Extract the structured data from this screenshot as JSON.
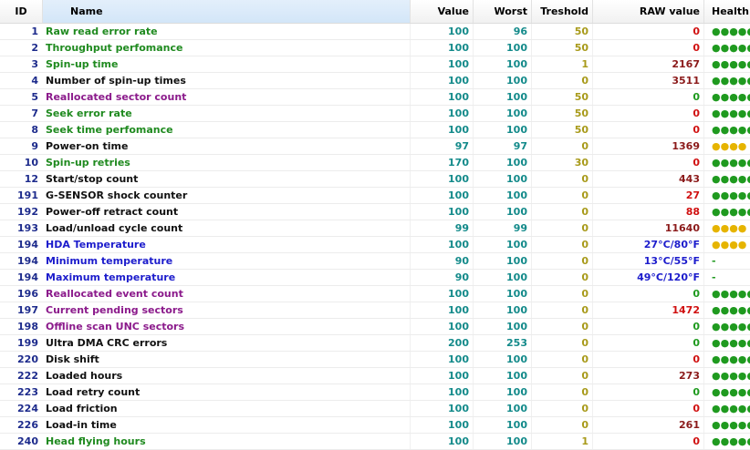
{
  "colors": {
    "name_default": "#111111",
    "name_green": "#1f8a1f",
    "name_purple": "#8b1a8b",
    "name_blue": "#1c1ccc",
    "raw_default": "#8b1a1a",
    "raw_red": "#d01010",
    "raw_green": "#1f9a1f",
    "raw_blue": "#1c1ccc",
    "health_good": "#1f9a1f",
    "health_warn": "#e6b400"
  },
  "headers": {
    "id": "ID",
    "name": "Name",
    "value": "Value",
    "worst": "Worst",
    "threshold": "Treshold",
    "raw": "RAW value",
    "health": "Health"
  },
  "rows": [
    {
      "id": "1",
      "name": "Raw read error rate",
      "name_color": "green",
      "value": "100",
      "worst": "96",
      "threshold": "50",
      "raw": "0",
      "raw_color": "red",
      "health": "●●●●●",
      "health_color": "good"
    },
    {
      "id": "2",
      "name": "Throughput perfomance",
      "name_color": "green",
      "value": "100",
      "worst": "100",
      "threshold": "50",
      "raw": "0",
      "raw_color": "red",
      "health": "●●●●●",
      "health_color": "good"
    },
    {
      "id": "3",
      "name": "Spin-up time",
      "name_color": "green",
      "value": "100",
      "worst": "100",
      "threshold": "1",
      "raw": "2167",
      "raw_color": "default",
      "health": "●●●●●",
      "health_color": "good"
    },
    {
      "id": "4",
      "name": "Number of spin-up times",
      "name_color": "default",
      "value": "100",
      "worst": "100",
      "threshold": "0",
      "raw": "3511",
      "raw_color": "default",
      "health": "●●●●●",
      "health_color": "good"
    },
    {
      "id": "5",
      "name": "Reallocated sector count",
      "name_color": "purple",
      "value": "100",
      "worst": "100",
      "threshold": "50",
      "raw": "0",
      "raw_color": "green",
      "health": "●●●●●",
      "health_color": "good"
    },
    {
      "id": "7",
      "name": "Seek error rate",
      "name_color": "green",
      "value": "100",
      "worst": "100",
      "threshold": "50",
      "raw": "0",
      "raw_color": "red",
      "health": "●●●●●",
      "health_color": "good"
    },
    {
      "id": "8",
      "name": "Seek time perfomance",
      "name_color": "green",
      "value": "100",
      "worst": "100",
      "threshold": "50",
      "raw": "0",
      "raw_color": "red",
      "health": "●●●●●",
      "health_color": "good"
    },
    {
      "id": "9",
      "name": "Power-on time",
      "name_color": "default",
      "value": "97",
      "worst": "97",
      "threshold": "0",
      "raw": "1369",
      "raw_color": "default",
      "health": "●●●●",
      "health_color": "warn"
    },
    {
      "id": "10",
      "name": "Spin-up retries",
      "name_color": "green",
      "value": "170",
      "worst": "100",
      "threshold": "30",
      "raw": "0",
      "raw_color": "red",
      "health": "●●●●●",
      "health_color": "good"
    },
    {
      "id": "12",
      "name": "Start/stop count",
      "name_color": "default",
      "value": "100",
      "worst": "100",
      "threshold": "0",
      "raw": "443",
      "raw_color": "default",
      "health": "●●●●●",
      "health_color": "good"
    },
    {
      "id": "191",
      "name": "G-SENSOR shock counter",
      "name_color": "default",
      "value": "100",
      "worst": "100",
      "threshold": "0",
      "raw": "27",
      "raw_color": "red",
      "health": "●●●●●",
      "health_color": "good"
    },
    {
      "id": "192",
      "name": "Power-off retract count",
      "name_color": "default",
      "value": "100",
      "worst": "100",
      "threshold": "0",
      "raw": "88",
      "raw_color": "red",
      "health": "●●●●●",
      "health_color": "good"
    },
    {
      "id": "193",
      "name": "Load/unload cycle count",
      "name_color": "default",
      "value": "99",
      "worst": "99",
      "threshold": "0",
      "raw": "11640",
      "raw_color": "default",
      "health": "●●●●",
      "health_color": "warn"
    },
    {
      "id": "194",
      "name": "HDA Temperature",
      "name_color": "blue",
      "value": "100",
      "worst": "100",
      "threshold": "0",
      "raw": "27°C/80°F",
      "raw_color": "blue",
      "health": "●●●●",
      "health_color": "warn"
    },
    {
      "id": "194",
      "name": "Minimum temperature",
      "name_color": "blue",
      "value": "90",
      "worst": "100",
      "threshold": "0",
      "raw": "13°C/55°F",
      "raw_color": "blue",
      "health": "-",
      "health_color": "good"
    },
    {
      "id": "194",
      "name": "Maximum temperature",
      "name_color": "blue",
      "value": "90",
      "worst": "100",
      "threshold": "0",
      "raw": "49°C/120°F",
      "raw_color": "blue",
      "health": "-",
      "health_color": "good"
    },
    {
      "id": "196",
      "name": "Reallocated event count",
      "name_color": "purple",
      "value": "100",
      "worst": "100",
      "threshold": "0",
      "raw": "0",
      "raw_color": "green",
      "health": "●●●●●",
      "health_color": "good"
    },
    {
      "id": "197",
      "name": "Current pending sectors",
      "name_color": "purple",
      "value": "100",
      "worst": "100",
      "threshold": "0",
      "raw": "1472",
      "raw_color": "red",
      "health": "●●●●●",
      "health_color": "good"
    },
    {
      "id": "198",
      "name": "Offline scan UNC sectors",
      "name_color": "purple",
      "value": "100",
      "worst": "100",
      "threshold": "0",
      "raw": "0",
      "raw_color": "green",
      "health": "●●●●●",
      "health_color": "good"
    },
    {
      "id": "199",
      "name": "Ultra DMA CRC errors",
      "name_color": "default",
      "value": "200",
      "worst": "253",
      "threshold": "0",
      "raw": "0",
      "raw_color": "green",
      "health": "●●●●●",
      "health_color": "good"
    },
    {
      "id": "220",
      "name": "Disk shift",
      "name_color": "default",
      "value": "100",
      "worst": "100",
      "threshold": "0",
      "raw": "0",
      "raw_color": "red",
      "health": "●●●●●",
      "health_color": "good"
    },
    {
      "id": "222",
      "name": "Loaded hours",
      "name_color": "default",
      "value": "100",
      "worst": "100",
      "threshold": "0",
      "raw": "273",
      "raw_color": "default",
      "health": "●●●●●",
      "health_color": "good"
    },
    {
      "id": "223",
      "name": "Load retry count",
      "name_color": "default",
      "value": "100",
      "worst": "100",
      "threshold": "0",
      "raw": "0",
      "raw_color": "green",
      "health": "●●●●●",
      "health_color": "good"
    },
    {
      "id": "224",
      "name": "Load friction",
      "name_color": "default",
      "value": "100",
      "worst": "100",
      "threshold": "0",
      "raw": "0",
      "raw_color": "red",
      "health": "●●●●●",
      "health_color": "good"
    },
    {
      "id": "226",
      "name": "Load-in time",
      "name_color": "default",
      "value": "100",
      "worst": "100",
      "threshold": "0",
      "raw": "261",
      "raw_color": "default",
      "health": "●●●●●",
      "health_color": "good"
    },
    {
      "id": "240",
      "name": "Head flying hours",
      "name_color": "green",
      "value": "100",
      "worst": "100",
      "threshold": "1",
      "raw": "0",
      "raw_color": "red",
      "health": "●●●●●",
      "health_color": "good"
    }
  ]
}
